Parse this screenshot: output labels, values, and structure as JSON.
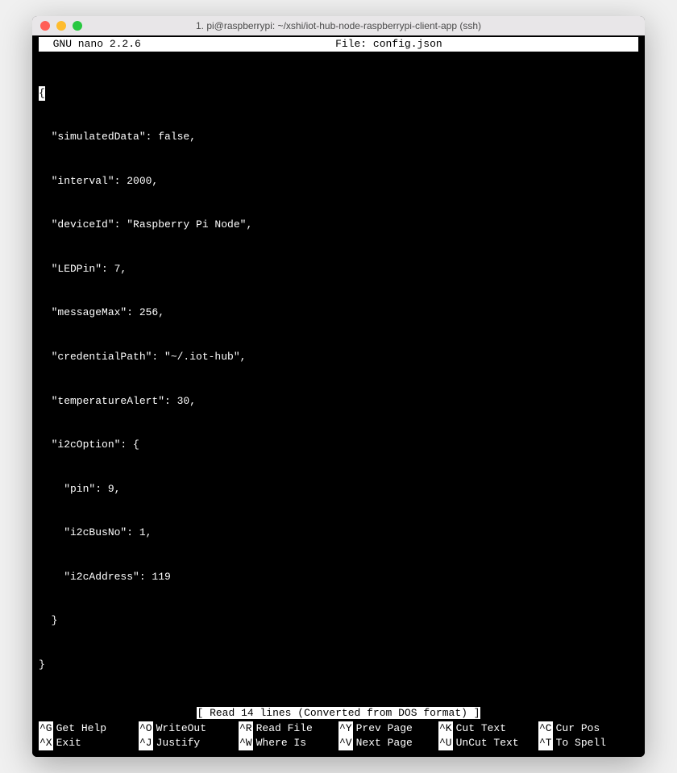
{
  "window": {
    "title": "1. pi@raspberrypi: ~/xshi/iot-hub-node-raspberrypi-client-app (ssh)"
  },
  "nano": {
    "version": "  GNU nano 2.2.6",
    "file_label": "File: config.json",
    "status": "[ Read 14 lines (Converted from DOS format) ]"
  },
  "content": {
    "l0": "{",
    "l1": "  \"simulatedData\": false,",
    "l2": "  \"interval\": 2000,",
    "l3": "  \"deviceId\": \"Raspberry Pi Node\",",
    "l4": "  \"LEDPin\": 7,",
    "l5": "  \"messageMax\": 256,",
    "l6": "  \"credentialPath\": \"~/.iot-hub\",",
    "l7": "  \"temperatureAlert\": 30,",
    "l8": "  \"i2cOption\": {",
    "l9": "    \"pin\": 9,",
    "l10": "    \"i2cBusNo\": 1,",
    "l11": "    \"i2cAddress\": 119",
    "l12": "  }",
    "l13": "}"
  },
  "shortcuts": {
    "r0c0k": "^G",
    "r0c0l": "Get Help",
    "r0c1k": "^O",
    "r0c1l": "WriteOut",
    "r0c2k": "^R",
    "r0c2l": "Read File",
    "r0c3k": "^Y",
    "r0c3l": "Prev Page",
    "r0c4k": "^K",
    "r0c4l": "Cut Text",
    "r0c5k": "^C",
    "r0c5l": "Cur Pos",
    "r1c0k": "^X",
    "r1c0l": "Exit",
    "r1c1k": "^J",
    "r1c1l": "Justify",
    "r1c2k": "^W",
    "r1c2l": "Where Is",
    "r1c3k": "^V",
    "r1c3l": "Next Page",
    "r1c4k": "^U",
    "r1c4l": "UnCut Text",
    "r1c5k": "^T",
    "r1c5l": "To Spell"
  }
}
